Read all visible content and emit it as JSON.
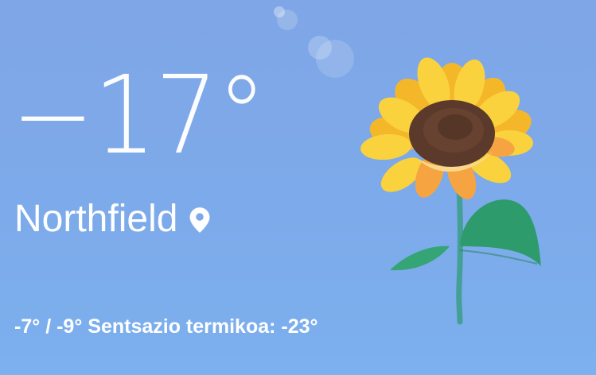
{
  "weather": {
    "temperature": "−17°",
    "location": "Northfield",
    "high": "-7°",
    "separator": "/",
    "low": "-9°",
    "feels_like_label": "Sentsazio termikoa:",
    "feels_like_value": "-23°"
  },
  "icons": {
    "location": "location-pin-icon",
    "illustration": "sunflower-illustration"
  },
  "colors": {
    "background": "#7fa6e6",
    "text": "#ffffff",
    "petal": "#f7c92e",
    "center": "#5a3a28",
    "stem": "#3aa37a"
  }
}
